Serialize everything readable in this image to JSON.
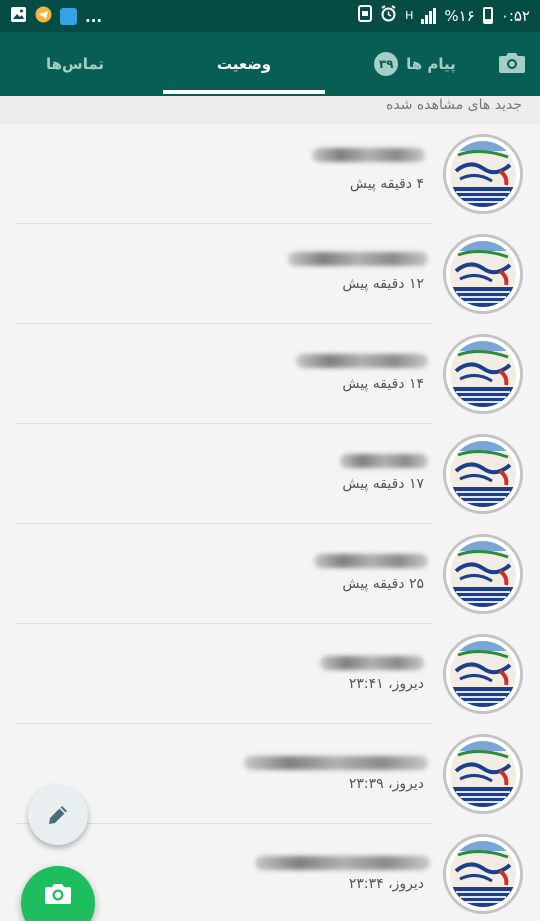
{
  "status_bar": {
    "time": "۰:۵۲",
    "battery": "%۱۶",
    "network": "H",
    "more": "..."
  },
  "tabs": {
    "contacts": "تماس‌ها",
    "status": "وضعیت",
    "chats": "پیام ها",
    "chats_count": "۳۹"
  },
  "section_header": "جدید های مشاهده شده",
  "statuses": [
    {
      "time": "۴ دقیقه پیش"
    },
    {
      "time": "۱۲ دقیقه پیش"
    },
    {
      "time": "۱۴ دقیقه پیش"
    },
    {
      "time": "۱۷ دقیقه پیش"
    },
    {
      "time": "۲۵ دقیقه پیش"
    },
    {
      "time": "دیروز، ۲۳:۴۱"
    },
    {
      "time": "دیروز، ۲۳:۳۹"
    },
    {
      "time": "دیروز، ۲۳:۳۴"
    }
  ],
  "colors": {
    "status_bar": "#054d44",
    "app_bar": "#075e54",
    "fab_green": "#1ebd5d"
  },
  "icons": [
    "camera-icon",
    "edit-pencil-icon",
    "camera-icon"
  ]
}
